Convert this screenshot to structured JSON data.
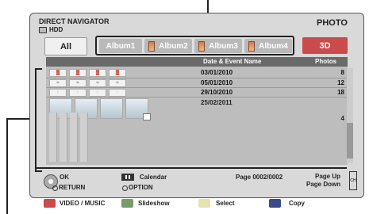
{
  "header": {
    "title": "DIRECT NAVIGATOR",
    "source": "HDD",
    "mode": "PHOTO"
  },
  "tabs": {
    "all": "All",
    "three_d": "3D"
  },
  "albums": [
    "Album1",
    "Album2",
    "Album3",
    "Album4"
  ],
  "list": {
    "col_date": "Date & Event Name",
    "col_photos": "Photos",
    "rows": [
      {
        "date": "03/01/2010",
        "photos": "8"
      },
      {
        "date": "05/01/2010",
        "photos": "12"
      },
      {
        "date": "29/10/2010",
        "photos": "18"
      },
      {
        "date": "25/02/2011",
        "photos": "4"
      }
    ]
  },
  "footer": {
    "ok": "OK",
    "return": "RETURN",
    "calendar": "Calendar",
    "option": "OPTION",
    "page": "Page 0002/0002",
    "page_up": "Page Up",
    "page_down": "Page Down",
    "ch": "CH",
    "video_music": "VIDEO / MUSIC",
    "slideshow": "Slideshow",
    "select": "Select",
    "copy": "Copy"
  },
  "colors": {
    "red": "#c94b4b",
    "green": "#7a9a6a",
    "yellow": "#e6e2b0",
    "blue": "#3a4a8a"
  }
}
